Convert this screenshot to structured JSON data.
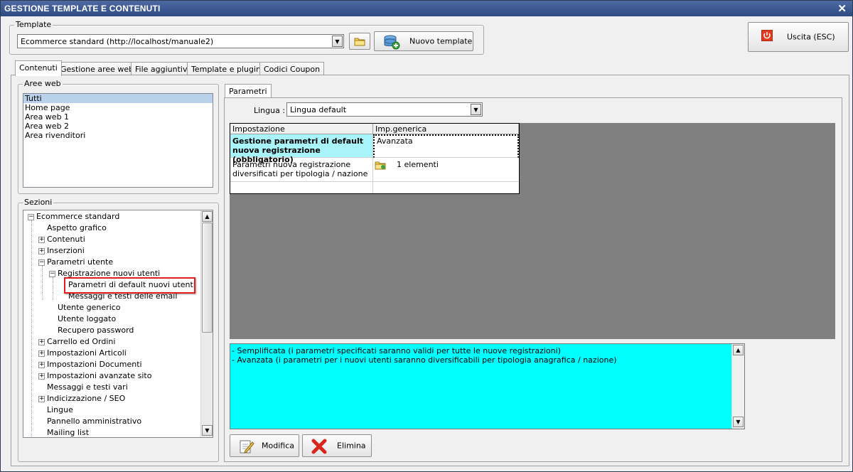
{
  "window": {
    "title": "GESTIONE TEMPLATE E CONTENUTI",
    "close_glyph": "✕"
  },
  "template_group": {
    "legend": "Template",
    "selected_value": "Ecommerce standard (http://localhost/manuale2)",
    "open_folder_icon": "folder-icon",
    "new_button_label": "Nuovo template"
  },
  "exit_button_label": "Uscita (ESC)",
  "tabs": [
    {
      "label": "Contenuti"
    },
    {
      "label": "Gestione aree web"
    },
    {
      "label": "File aggiuntivi"
    },
    {
      "label": "Template e plugins"
    },
    {
      "label": "Codici Coupon"
    }
  ],
  "aree_web": {
    "legend": "Aree web",
    "items": [
      "Tutti",
      "Home page",
      "Area web 1",
      "Area web 2",
      "Area rivenditori"
    ],
    "selected_index": 0
  },
  "sezioni": {
    "legend": "Sezioni",
    "nodes": [
      {
        "label": "Ecommerce standard",
        "expander": "−"
      },
      {
        "label": "Aspetto grafico",
        "expander": ""
      },
      {
        "label": "Contenuti",
        "expander": "+"
      },
      {
        "label": "Inserzioni",
        "expander": "+"
      },
      {
        "label": "Parametri utente",
        "expander": "−"
      },
      {
        "label": "Registrazione nuovi utenti",
        "expander": "−"
      },
      {
        "label": "Parametri di default nuovi utenti",
        "expander": ""
      },
      {
        "label": "Messaggi e testi delle email",
        "expander": ""
      },
      {
        "label": "Utente generico",
        "expander": ""
      },
      {
        "label": "Utente loggato",
        "expander": ""
      },
      {
        "label": "Recupero password",
        "expander": ""
      },
      {
        "label": "Carrello ed Ordini",
        "expander": "+"
      },
      {
        "label": "Impostazioni Articoli",
        "expander": "+"
      },
      {
        "label": "Impostazioni Documenti",
        "expander": "+"
      },
      {
        "label": "Impostazioni avanzate sito",
        "expander": "+"
      },
      {
        "label": "Messaggi e testi vari",
        "expander": ""
      },
      {
        "label": "Indicizzazione / SEO",
        "expander": "+"
      },
      {
        "label": "Lingue",
        "expander": ""
      },
      {
        "label": "Pannello amministrativo",
        "expander": ""
      },
      {
        "label": "Mailing list",
        "expander": ""
      }
    ]
  },
  "parametri": {
    "tab_label": "Parametri",
    "lingua_label": "Lingua :",
    "lingua_value": "Lingua default",
    "grid": {
      "headers": [
        "Impostazione",
        "Imp.generica"
      ],
      "rows": [
        {
          "setting": "Gestione parametri di default nuova registrazione (obbligatorio)",
          "value": "Avanzata"
        },
        {
          "setting": "Parametri nuova registrazione diversificati per tipologia / nazione",
          "value": "1 elementi"
        }
      ]
    },
    "description_lines": [
      "- Semplificata (i parametri specificati saranno validi per tutte le nuove registrazioni)",
      "- Avanzata (i parametri per i nuovi utenti saranno diversificabili per tipologia anagrafica / nazione)"
    ],
    "modify_label": "Modifica",
    "delete_label": "Elimina"
  },
  "colors": {
    "title_bar": "#2f4a82",
    "description_bg": "#00ffff",
    "grid_bg": "#808080",
    "highlight": "#e02020",
    "selected_row": "#b9d1ea"
  }
}
